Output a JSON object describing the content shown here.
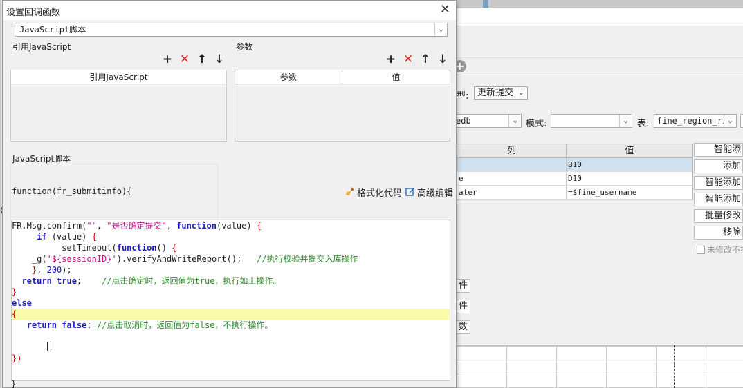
{
  "dialog": {
    "title": "设置回调函数",
    "script_type": "JavaScript脚本",
    "imports": {
      "label": "引用JavaScript",
      "column": "引用JavaScript"
    },
    "params": {
      "label": "参数",
      "columns": [
        "参数",
        "值"
      ]
    },
    "script_label": "JavaScript脚本",
    "function_signature": "function(fr_submitinfo){",
    "format_code": "格式化代码",
    "advanced_edit": "高级编辑",
    "code_lines": [
      [
        {
          "t": "FR.Msg.confirm(",
          "c": ""
        },
        {
          "t": "\"\"",
          "c": "st"
        },
        {
          "t": ", ",
          "c": ""
        },
        {
          "t": "\"是否确定提交\"",
          "c": "st"
        },
        {
          "t": ", ",
          "c": ""
        },
        {
          "t": "function",
          "c": "kw"
        },
        {
          "t": "(value) ",
          "c": ""
        },
        {
          "t": "{",
          "c": "br"
        }
      ],
      [
        {
          "t": "     ",
          "c": ""
        },
        {
          "t": "if",
          "c": "kw"
        },
        {
          "t": " (value) ",
          "c": ""
        },
        {
          "t": "{",
          "c": "br"
        }
      ],
      [
        {
          "t": "          setTimeout(",
          "c": ""
        },
        {
          "t": "function",
          "c": "kw"
        },
        {
          "t": "() ",
          "c": ""
        },
        {
          "t": "{",
          "c": "br"
        }
      ],
      [
        {
          "t": "    _g(",
          "c": ""
        },
        {
          "t": "'${sessionID}'",
          "c": "st"
        },
        {
          "t": ").verifyAndWriteReport();   ",
          "c": ""
        },
        {
          "t": "//执行校验并提交入库操作",
          "c": "cm"
        }
      ],
      [
        {
          "t": "    ",
          "c": ""
        },
        {
          "t": "}",
          "c": "br"
        },
        {
          "t": ", ",
          "c": ""
        },
        {
          "t": "200",
          "c": "num"
        },
        {
          "t": ");",
          "c": ""
        }
      ],
      [
        {
          "t": "  ",
          "c": ""
        },
        {
          "t": "return",
          "c": "kw"
        },
        {
          "t": " ",
          "c": ""
        },
        {
          "t": "true",
          "c": "kw"
        },
        {
          "t": ";    ",
          "c": ""
        },
        {
          "t": "//点击确定时，返回值为true，执行如上操作。",
          "c": "cm"
        }
      ],
      [
        {
          "t": "}",
          "c": "br"
        }
      ],
      [
        {
          "t": "else",
          "c": "kw"
        }
      ],
      [
        {
          "t": "{",
          "c": "br"
        }
      ],
      [
        {
          "t": "   ",
          "c": ""
        },
        {
          "t": "return",
          "c": "kw"
        },
        {
          "t": " ",
          "c": ""
        },
        {
          "t": "false",
          "c": "kw"
        },
        {
          "t": "; ",
          "c": ""
        },
        {
          "t": "//点击取消时，返回值为false，不执行操作。",
          "c": "cm"
        }
      ],
      [],
      [
        {
          "t": "       ",
          "c": ""
        },
        {
          "t": "}",
          "c": "cursor"
        }
      ],
      [
        {
          "t": "})",
          "c": "br"
        }
      ]
    ],
    "closing_brace": "}"
  },
  "background": {
    "type_label": "型:",
    "type_value": "更新提交",
    "db_value": "edb",
    "mode_label": "模式:",
    "mode_value": "",
    "table_label": "表:",
    "table_value": "fine_region_rig",
    "grid_columns": [
      "列",
      "值"
    ],
    "grid_rows": [
      {
        "col": "",
        "val": "B10",
        "selected": true
      },
      {
        "col": "e",
        "val": "D10",
        "selected": false
      },
      {
        "col": "ater",
        "val": "=$fine_username",
        "selected": false
      }
    ],
    "buttons": [
      "智能添",
      "添加",
      "智能添加",
      "智能添加",
      "批量修改",
      "移除"
    ],
    "checkbox_label": "未修改不提",
    "side_buttons": [
      "件",
      "件",
      "数"
    ]
  }
}
